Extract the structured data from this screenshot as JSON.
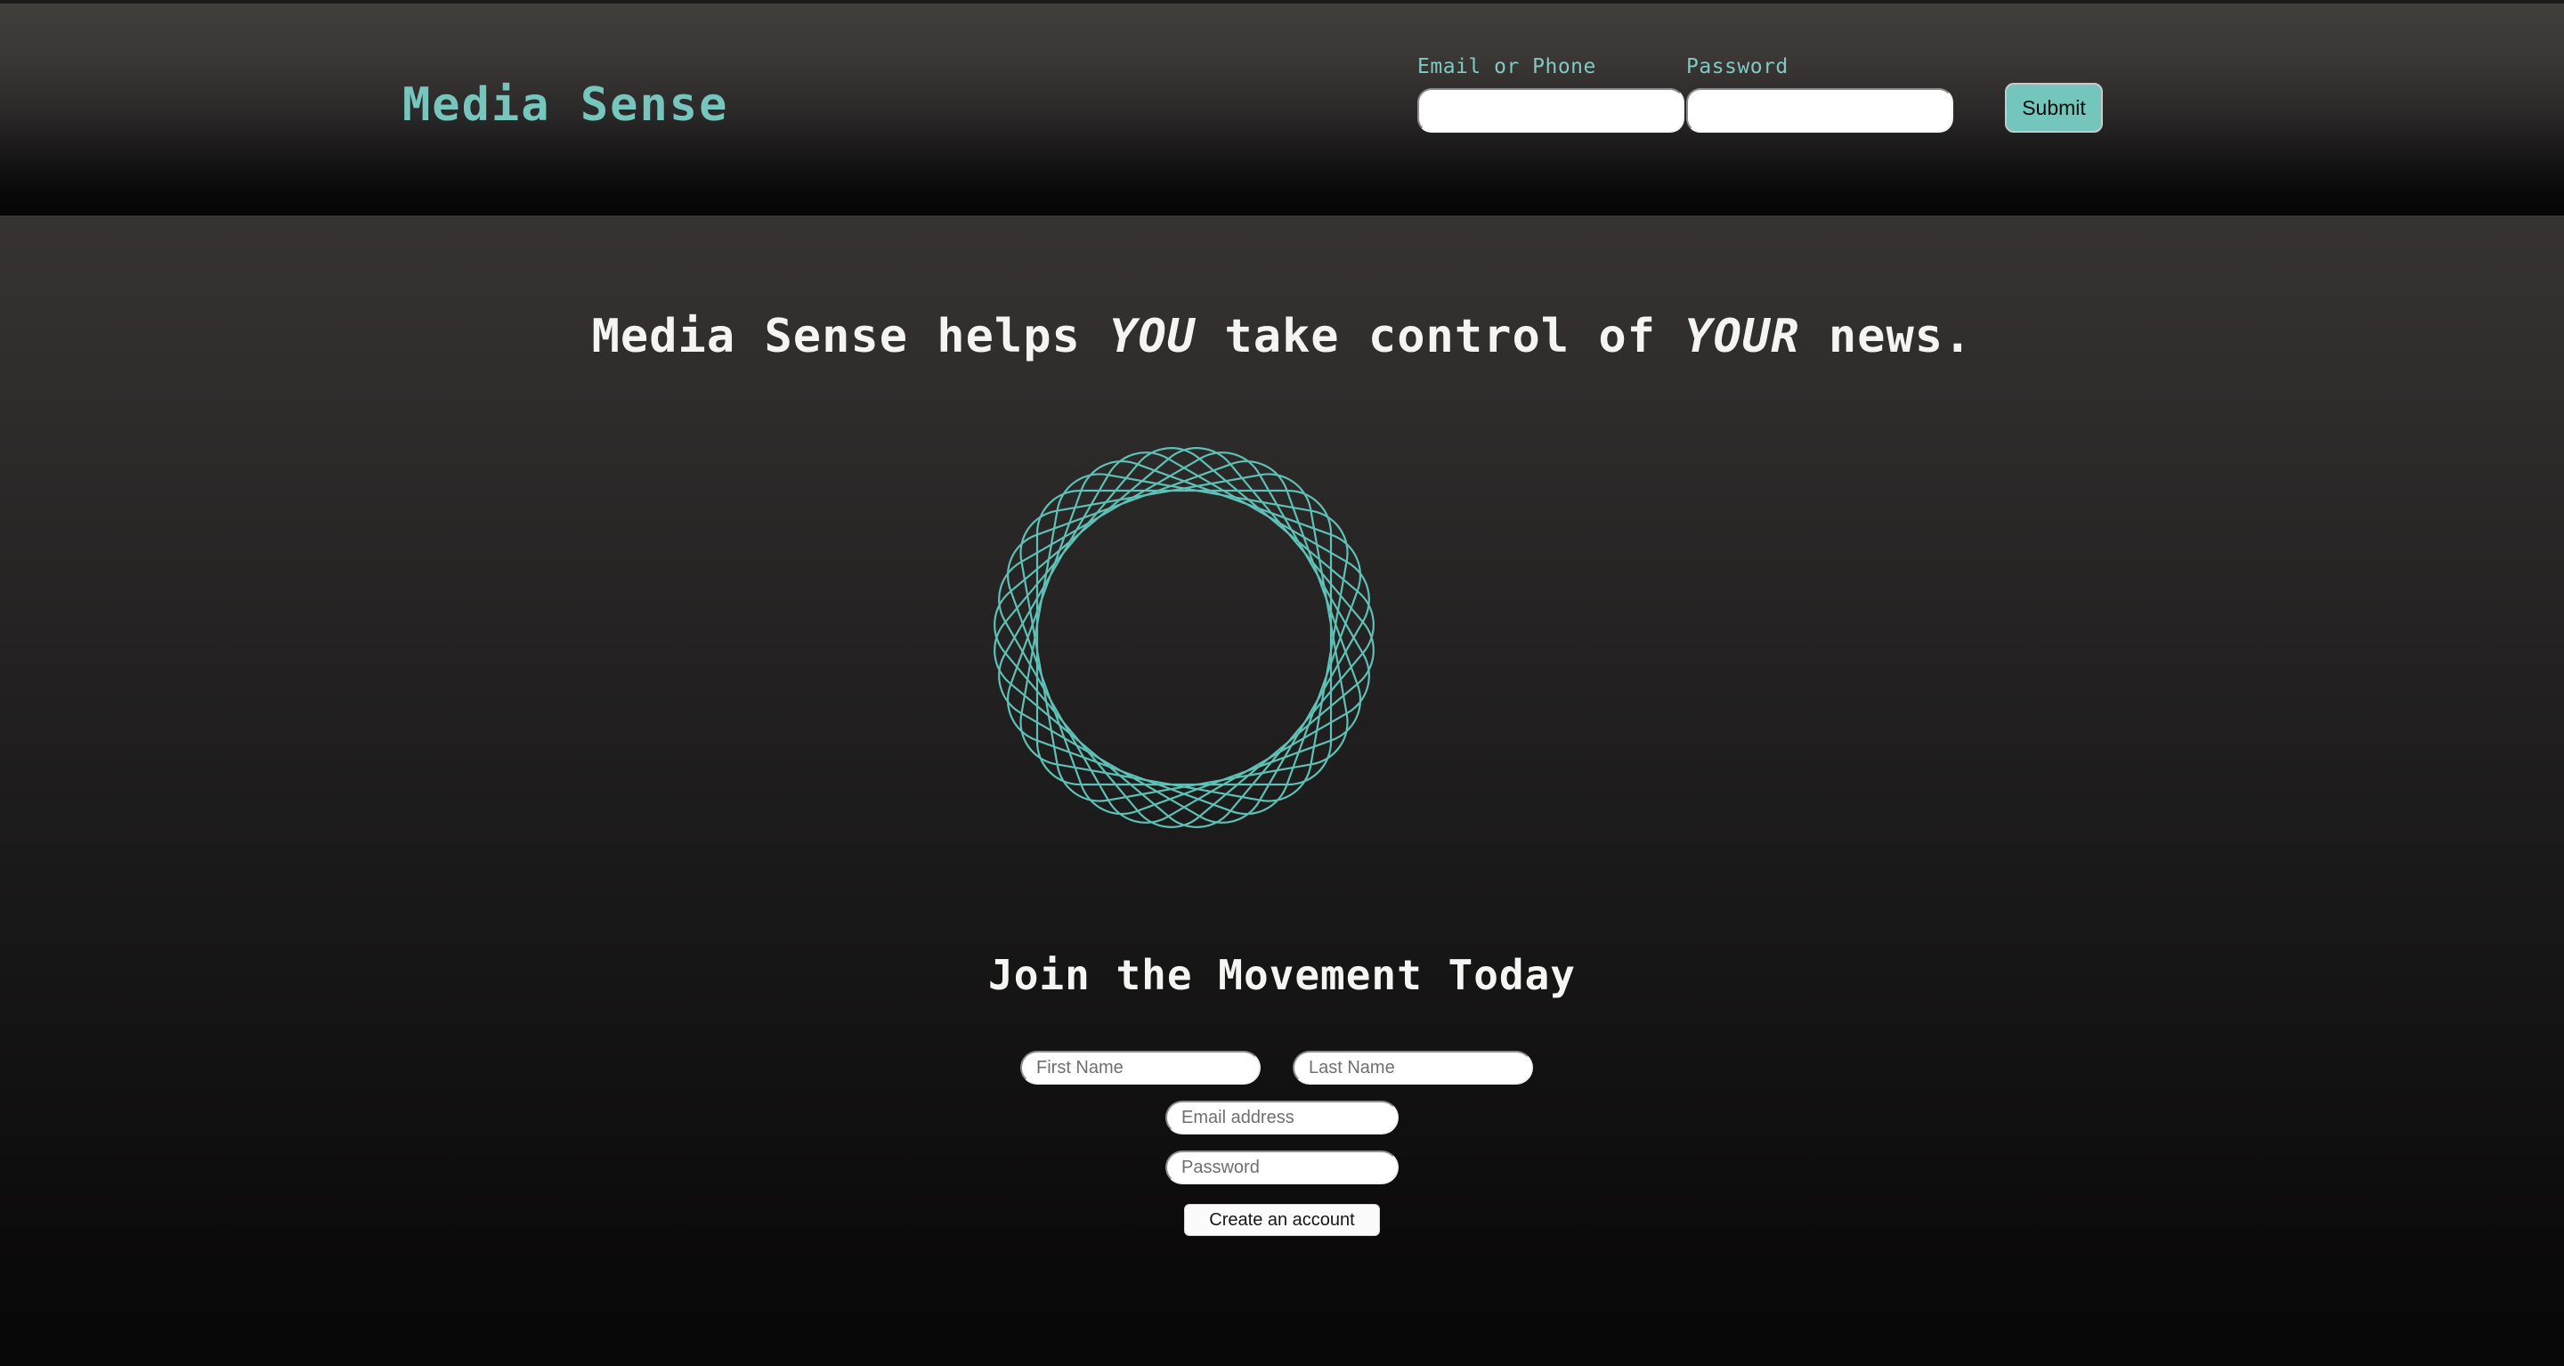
{
  "site": {
    "logo_text": "Media Sense",
    "accent_color": "#76c6bd",
    "text_color": "#f4f4f2",
    "background_top": "#3c3937",
    "background_bottom": "#080808"
  },
  "header": {
    "login": {
      "email_label": "Email or Phone",
      "email_value": "",
      "email_placeholder": "",
      "password_label": "Password",
      "password_value": "",
      "password_placeholder": "",
      "submit_label": "Submit"
    }
  },
  "hero": {
    "headline_part1": "Media Sense helps ",
    "headline_emphasis1": "YOU",
    "headline_part2": " take control of ",
    "headline_emphasis2": "YOUR",
    "headline_part3": " news.",
    "graphic": {
      "name": "spirograph-rounded-squares",
      "stroke_color": "#5fc0b5",
      "shape_count": 9,
      "rotation_step_degrees": 10
    }
  },
  "signup": {
    "heading": "Join the Movement Today",
    "first_name_placeholder": "First Name",
    "first_name_value": "",
    "last_name_placeholder": "Last Name",
    "last_name_value": "",
    "email_placeholder": "Email address",
    "email_value": "",
    "password_placeholder": "Password",
    "password_value": "",
    "submit_label": "Create an account"
  }
}
